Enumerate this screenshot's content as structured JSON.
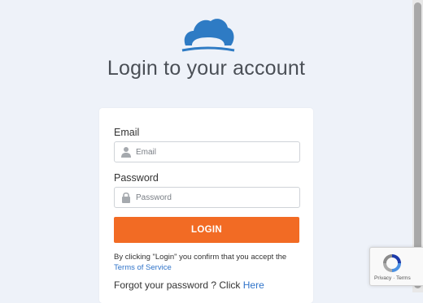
{
  "header": {
    "logo_icon": "cloud-logo-icon",
    "title": "Login to your account"
  },
  "form": {
    "email_label": "Email",
    "email_placeholder": "Email",
    "email_value": "",
    "password_label": "Password",
    "password_placeholder": "Password",
    "password_value": "",
    "login_label": "LOGIN",
    "terms_text": "By clicking \"Login\" you confirm that you accept the",
    "terms_link": "Terms of Service",
    "forgot_text": "Forgot your password ? Click",
    "forgot_link": "Here"
  },
  "recaptcha": {
    "privacy": "Privacy",
    "separator": "·",
    "terms": "Terms"
  },
  "colors": {
    "accent": "#f26b24",
    "link": "#2f73c9",
    "logo": "#2e7bc4",
    "background": "#eef2f9"
  }
}
